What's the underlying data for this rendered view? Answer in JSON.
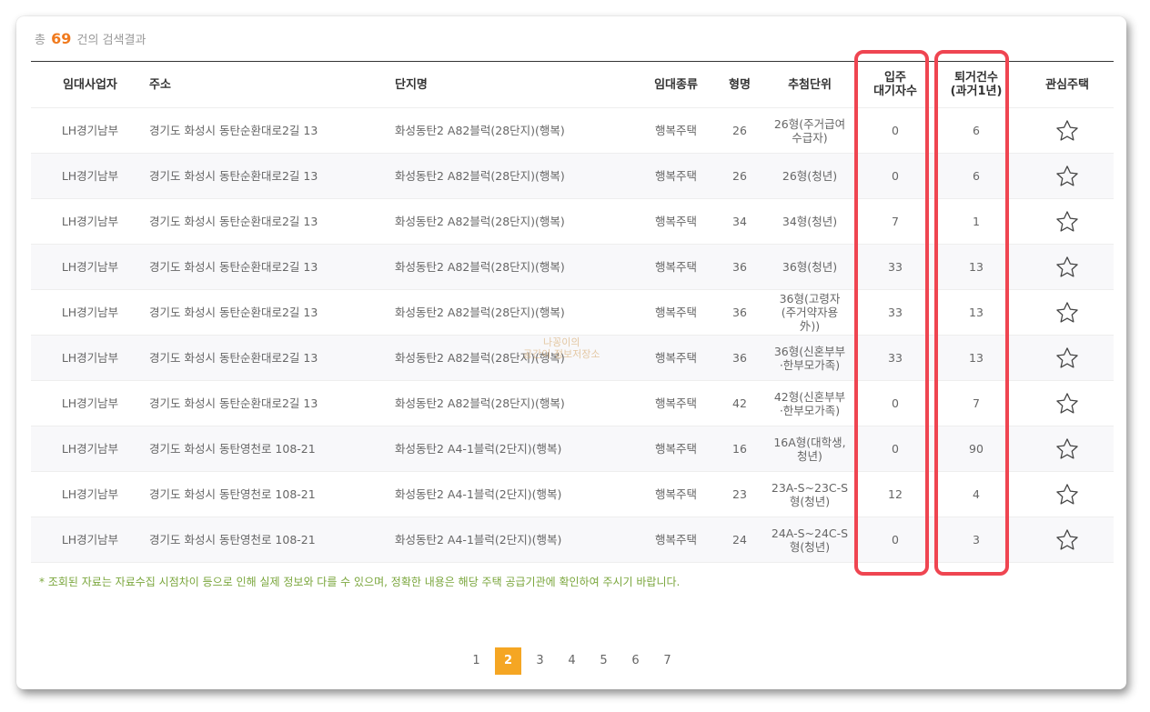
{
  "summary": {
    "prefix": "총",
    "count": "69",
    "suffix": "건의 검색결과"
  },
  "columns": {
    "provider": "임대사업자",
    "address": "주소",
    "complex": "단지명",
    "rental_type": "임대종류",
    "size": "형명",
    "lottery_unit": "추첨단위",
    "waiting_line1": "입주",
    "waiting_line2": "대기자수",
    "moveout_line1": "퇴거건수",
    "moveout_line2": "(과거1년)",
    "favorite": "관심주택"
  },
  "rows": [
    {
      "provider": "LH경기남부",
      "address": "경기도 화성시 동탄순환대로2길 13",
      "complex": "화성동탄2 A82블럭(28단지)(행복)",
      "rental_type": "행복주택",
      "size": "26",
      "unit_line1": "26형(주거급여",
      "unit_line2": "수급자)",
      "unit_line3": "",
      "waiting": "0",
      "moveouts": "6"
    },
    {
      "provider": "LH경기남부",
      "address": "경기도 화성시 동탄순환대로2길 13",
      "complex": "화성동탄2 A82블럭(28단지)(행복)",
      "rental_type": "행복주택",
      "size": "26",
      "unit_line1": "26형(청년)",
      "unit_line2": "",
      "unit_line3": "",
      "waiting": "0",
      "moveouts": "6"
    },
    {
      "provider": "LH경기남부",
      "address": "경기도 화성시 동탄순환대로2길 13",
      "complex": "화성동탄2 A82블럭(28단지)(행복)",
      "rental_type": "행복주택",
      "size": "34",
      "unit_line1": "34형(청년)",
      "unit_line2": "",
      "unit_line3": "",
      "waiting": "7",
      "moveouts": "1"
    },
    {
      "provider": "LH경기남부",
      "address": "경기도 화성시 동탄순환대로2길 13",
      "complex": "화성동탄2 A82블럭(28단지)(행복)",
      "rental_type": "행복주택",
      "size": "36",
      "unit_line1": "36형(청년)",
      "unit_line2": "",
      "unit_line3": "",
      "waiting": "33",
      "moveouts": "13"
    },
    {
      "provider": "LH경기남부",
      "address": "경기도 화성시 동탄순환대로2길 13",
      "complex": "화성동탄2 A82블럭(28단지)(행복)",
      "rental_type": "행복주택",
      "size": "36",
      "unit_line1": "36형(고령자",
      "unit_line2": "(주거약자용",
      "unit_line3": "外))",
      "waiting": "33",
      "moveouts": "13"
    },
    {
      "provider": "LH경기남부",
      "address": "경기도 화성시 동탄순환대로2길 13",
      "complex": "화성동탄2 A82블럭(28단지)(행복)",
      "rental_type": "행복주택",
      "size": "36",
      "unit_line1": "36형(신혼부부",
      "unit_line2": "·한부모가족)",
      "unit_line3": "",
      "waiting": "33",
      "moveouts": "13"
    },
    {
      "provider": "LH경기남부",
      "address": "경기도 화성시 동탄순환대로2길 13",
      "complex": "화성동탄2 A82블럭(28단지)(행복)",
      "rental_type": "행복주택",
      "size": "42",
      "unit_line1": "42형(신혼부부",
      "unit_line2": "·한부모가족)",
      "unit_line3": "",
      "waiting": "0",
      "moveouts": "7"
    },
    {
      "provider": "LH경기남부",
      "address": "경기도 화성시 동탄영천로 108-21",
      "complex": "화성동탄2 A4-1블럭(2단지)(행복)",
      "rental_type": "행복주택",
      "size": "16",
      "unit_line1": "16A형(대학생,",
      "unit_line2": "청년)",
      "unit_line3": "",
      "waiting": "0",
      "moveouts": "90"
    },
    {
      "provider": "LH경기남부",
      "address": "경기도 화성시 동탄영천로 108-21",
      "complex": "화성동탄2 A4-1블럭(2단지)(행복)",
      "rental_type": "행복주택",
      "size": "23",
      "unit_line1": "23A-S~23C-S",
      "unit_line2": "형(청년)",
      "unit_line3": "",
      "waiting": "12",
      "moveouts": "4"
    },
    {
      "provider": "LH경기남부",
      "address": "경기도 화성시 동탄영천로 108-21",
      "complex": "화성동탄2 A4-1블럭(2단지)(행복)",
      "rental_type": "행복주택",
      "size": "24",
      "unit_line1": "24A-S~24C-S",
      "unit_line2": "형(청년)",
      "unit_line3": "",
      "waiting": "0",
      "moveouts": "3"
    }
  ],
  "notice": "* 조회된 자료는 자료수집 시점차이 등으로 인해 실제 정보와 다를 수 있으며, 정확한 내용은 해당 주택 공급기관에 확인하여 주시기 바랍니다.",
  "pagination": {
    "pages": [
      "1",
      "2",
      "3",
      "4",
      "5",
      "6",
      "7"
    ],
    "current": "2"
  },
  "watermark": {
    "line1": "나꽁이의",
    "line2": "공간이 정보저장소"
  },
  "colors": {
    "accent": "#f5a623",
    "count": "#f07a1e",
    "highlight": "#ef4551",
    "notice": "#7aa63c"
  },
  "icons": {
    "favorite": "star-outline-icon"
  }
}
